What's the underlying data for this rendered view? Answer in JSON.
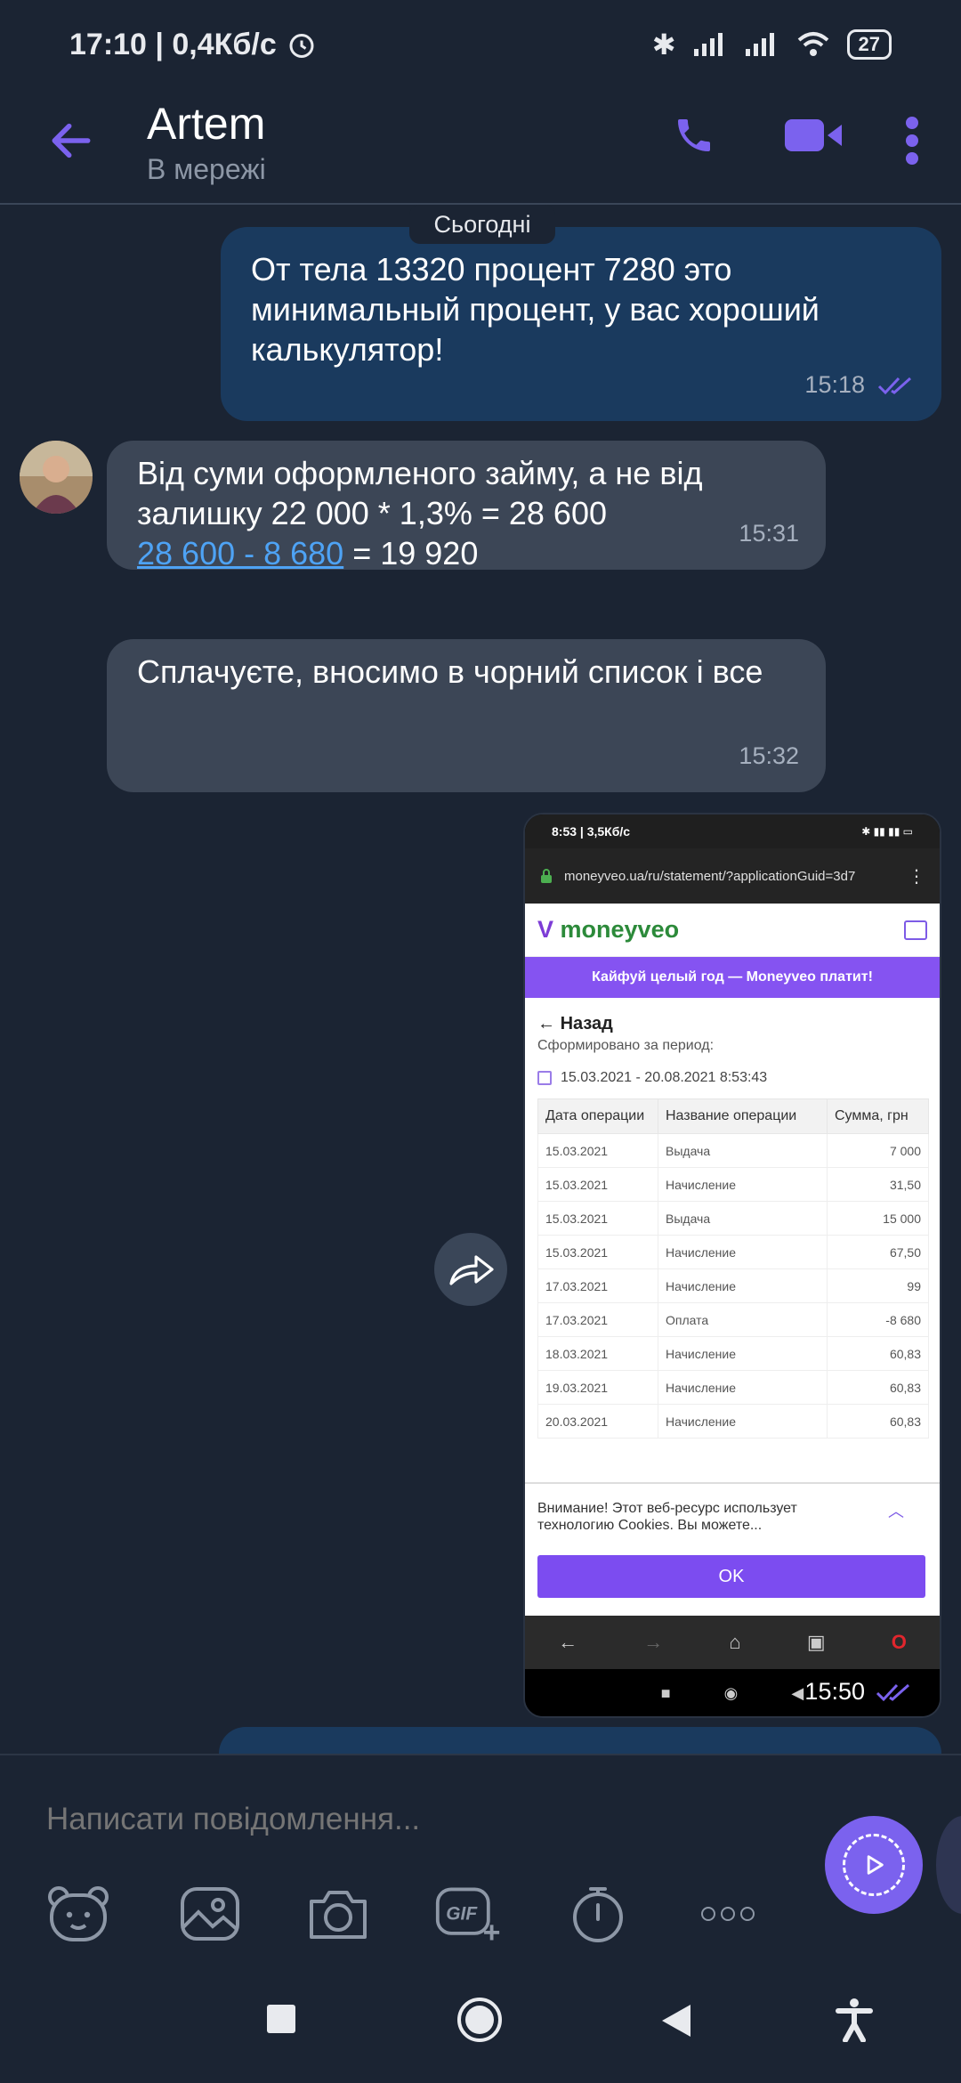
{
  "status_bar": {
    "time": "17:10 | 0,4Кб/с",
    "battery": "27"
  },
  "header": {
    "name": "Artem",
    "status": "В мережі"
  },
  "chat": {
    "date_separator": "Сьогодні",
    "messages": [
      {
        "direction": "out",
        "text": "От тела 13320 процент 7280 это минимальный процент, у вас хороший калькулятор!",
        "time": "15:18"
      },
      {
        "direction": "in",
        "line1": "Від суми оформленого займу, а не  від залишку 22 000 * 1,3% = 28 600",
        "link": "28 600 - 8 680",
        "after_link": " = 19 920",
        "time": "15:31"
      },
      {
        "direction": "in",
        "text": "Сплачуєте, вносимо в чорний список і все",
        "time": "15:32"
      },
      {
        "direction": "out",
        "type": "image",
        "time": "15:50"
      }
    ]
  },
  "screenshot": {
    "status_time": "8:53 | 3,5Кб/с",
    "url": "moneyveo.ua/ru/statement/?applicationGuid=3d7",
    "logo": "moneyveo",
    "banner": "Кайфуй целый год — Moneyveo платит!",
    "back": "Назад",
    "period_label": "Сформировано за период:",
    "period_range": "15.03.2021 - 20.08.2021 8:53:43",
    "table_headers": [
      "Дата операции",
      "Название операции",
      "Сумма, грн"
    ],
    "rows": [
      [
        "15.03.2021",
        "Выдача",
        "7 000"
      ],
      [
        "15.03.2021",
        "Начисление",
        "31,50"
      ],
      [
        "15.03.2021",
        "Выдача",
        "15 000"
      ],
      [
        "15.03.2021",
        "Начисление",
        "67,50"
      ],
      [
        "17.03.2021",
        "Начисление",
        "99"
      ],
      [
        "17.03.2021",
        "Оплата",
        "-8 680"
      ],
      [
        "18.03.2021",
        "Начисление",
        "60,83"
      ],
      [
        "19.03.2021",
        "Начисление",
        "60,83"
      ],
      [
        "20.03.2021",
        "Начисление",
        "60,83"
      ]
    ],
    "cookie_text": "Внимание! Этот веб-ресурс использует технологию Cookies. Вы можете...",
    "ok": "OK"
  },
  "composer": {
    "placeholder": "Написати повідомлення..."
  },
  "toolbar": {
    "gif_label": "GIF"
  },
  "colors": {
    "accent": "#7b62ee",
    "outgoing_bubble": "#1a3a5e",
    "incoming_bubble": "#3c4656",
    "background": "#1b2433",
    "link": "#4ea3f5"
  }
}
